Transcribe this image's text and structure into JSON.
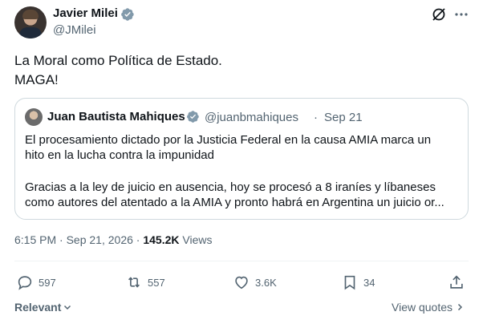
{
  "author": {
    "name": "Javier Milei",
    "handle": "@JMilei",
    "verified_color": "#829aab"
  },
  "tweet": {
    "line1": "La Moral como Política de Estado.",
    "line2": "MAGA!"
  },
  "quoted": {
    "name": "Juan Bautista Mahiques",
    "handle": "@juanbmahiques",
    "separator": "·",
    "date": "Sep 21",
    "line1": "El procesamiento dictado por la Justicia Federal en la causa AMIA marca un",
    "line2": "hito en la lucha contra la impunidad",
    "line3": "Gracias a la ley de juicio en ausencia, hoy se procesó a 8 iraníes y líbaneses",
    "line4": "como autores del atentado a la AMIA y pronto habrá en Argentina un juicio or..."
  },
  "meta": {
    "time": "6:15 PM",
    "sep1": "·",
    "date": "Sep 21, 2026",
    "sep2": "·",
    "views_count": "145.2K",
    "views_label": "Views"
  },
  "actions": {
    "replies": "597",
    "reposts": "557",
    "likes": "3.6K",
    "bookmarks": "34"
  },
  "footer": {
    "sort_label": "Relevant",
    "view_quotes": "View quotes"
  },
  "icons": {
    "verified": "verified-badge-icon",
    "grok": "grok-icon",
    "more": "more-icon",
    "reply": "reply-icon",
    "repost": "repost-icon",
    "like": "heart-icon",
    "bookmark": "bookmark-icon",
    "share": "share-icon"
  },
  "colors": {
    "text": "#0f1419",
    "secondary": "#536471",
    "border": "#cfd9de"
  }
}
